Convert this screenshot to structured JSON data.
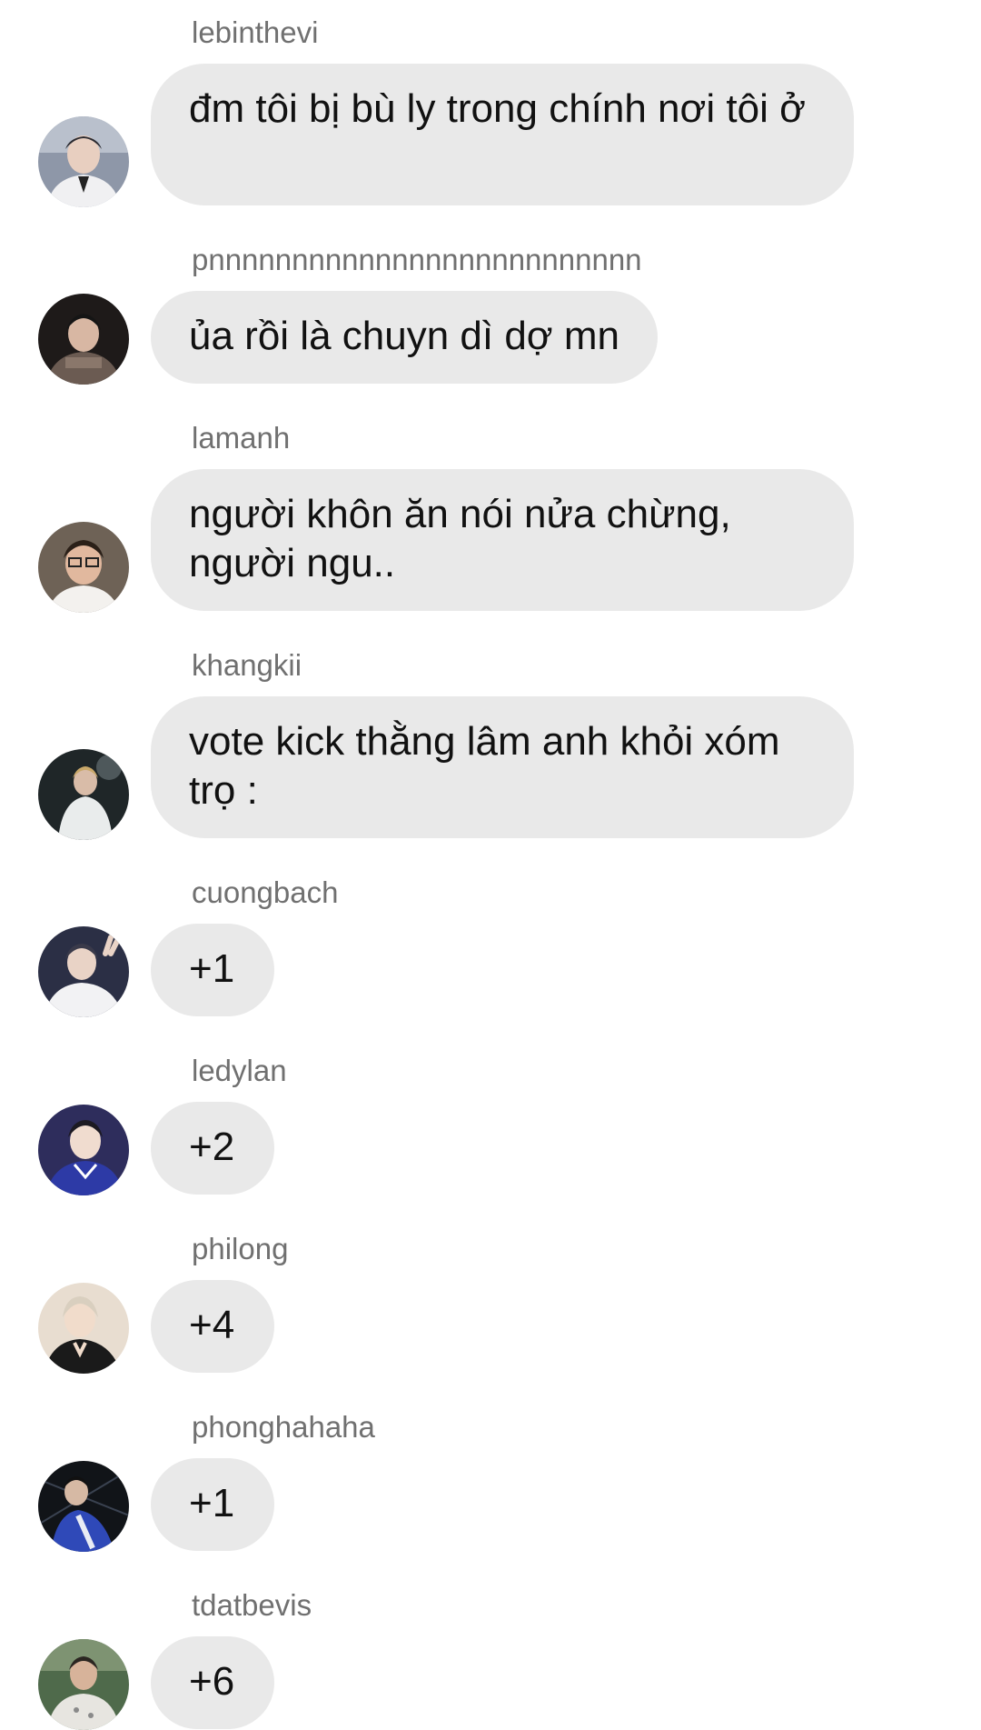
{
  "messages": [
    {
      "sender": "lebinthevi",
      "text": "đm tôi bị bù ly trong chính nơi tôi ở"
    },
    {
      "sender": "pnnnnnnnnnnnnnnnnnnnnnnnnnn",
      "text": "ủa rồi là chuyn dì dợ mn"
    },
    {
      "sender": "lamanh",
      "text": "người khôn ăn nói nửa chừng, người ngu.."
    },
    {
      "sender": "khangkii",
      "text": "vote kick thằng lâm anh khỏi xóm trọ :"
    },
    {
      "sender": "cuongbach",
      "text": "+1"
    },
    {
      "sender": "ledylan",
      "text": "+2"
    },
    {
      "sender": "philong",
      "text": "+4"
    },
    {
      "sender": "phonghahaha",
      "text": "+1"
    },
    {
      "sender": "tdatbevis",
      "text": "+6"
    }
  ],
  "colors": {
    "bubble": "#e9e9e9",
    "sender": "#707070",
    "text": "#111111",
    "background": "#ffffff"
  }
}
